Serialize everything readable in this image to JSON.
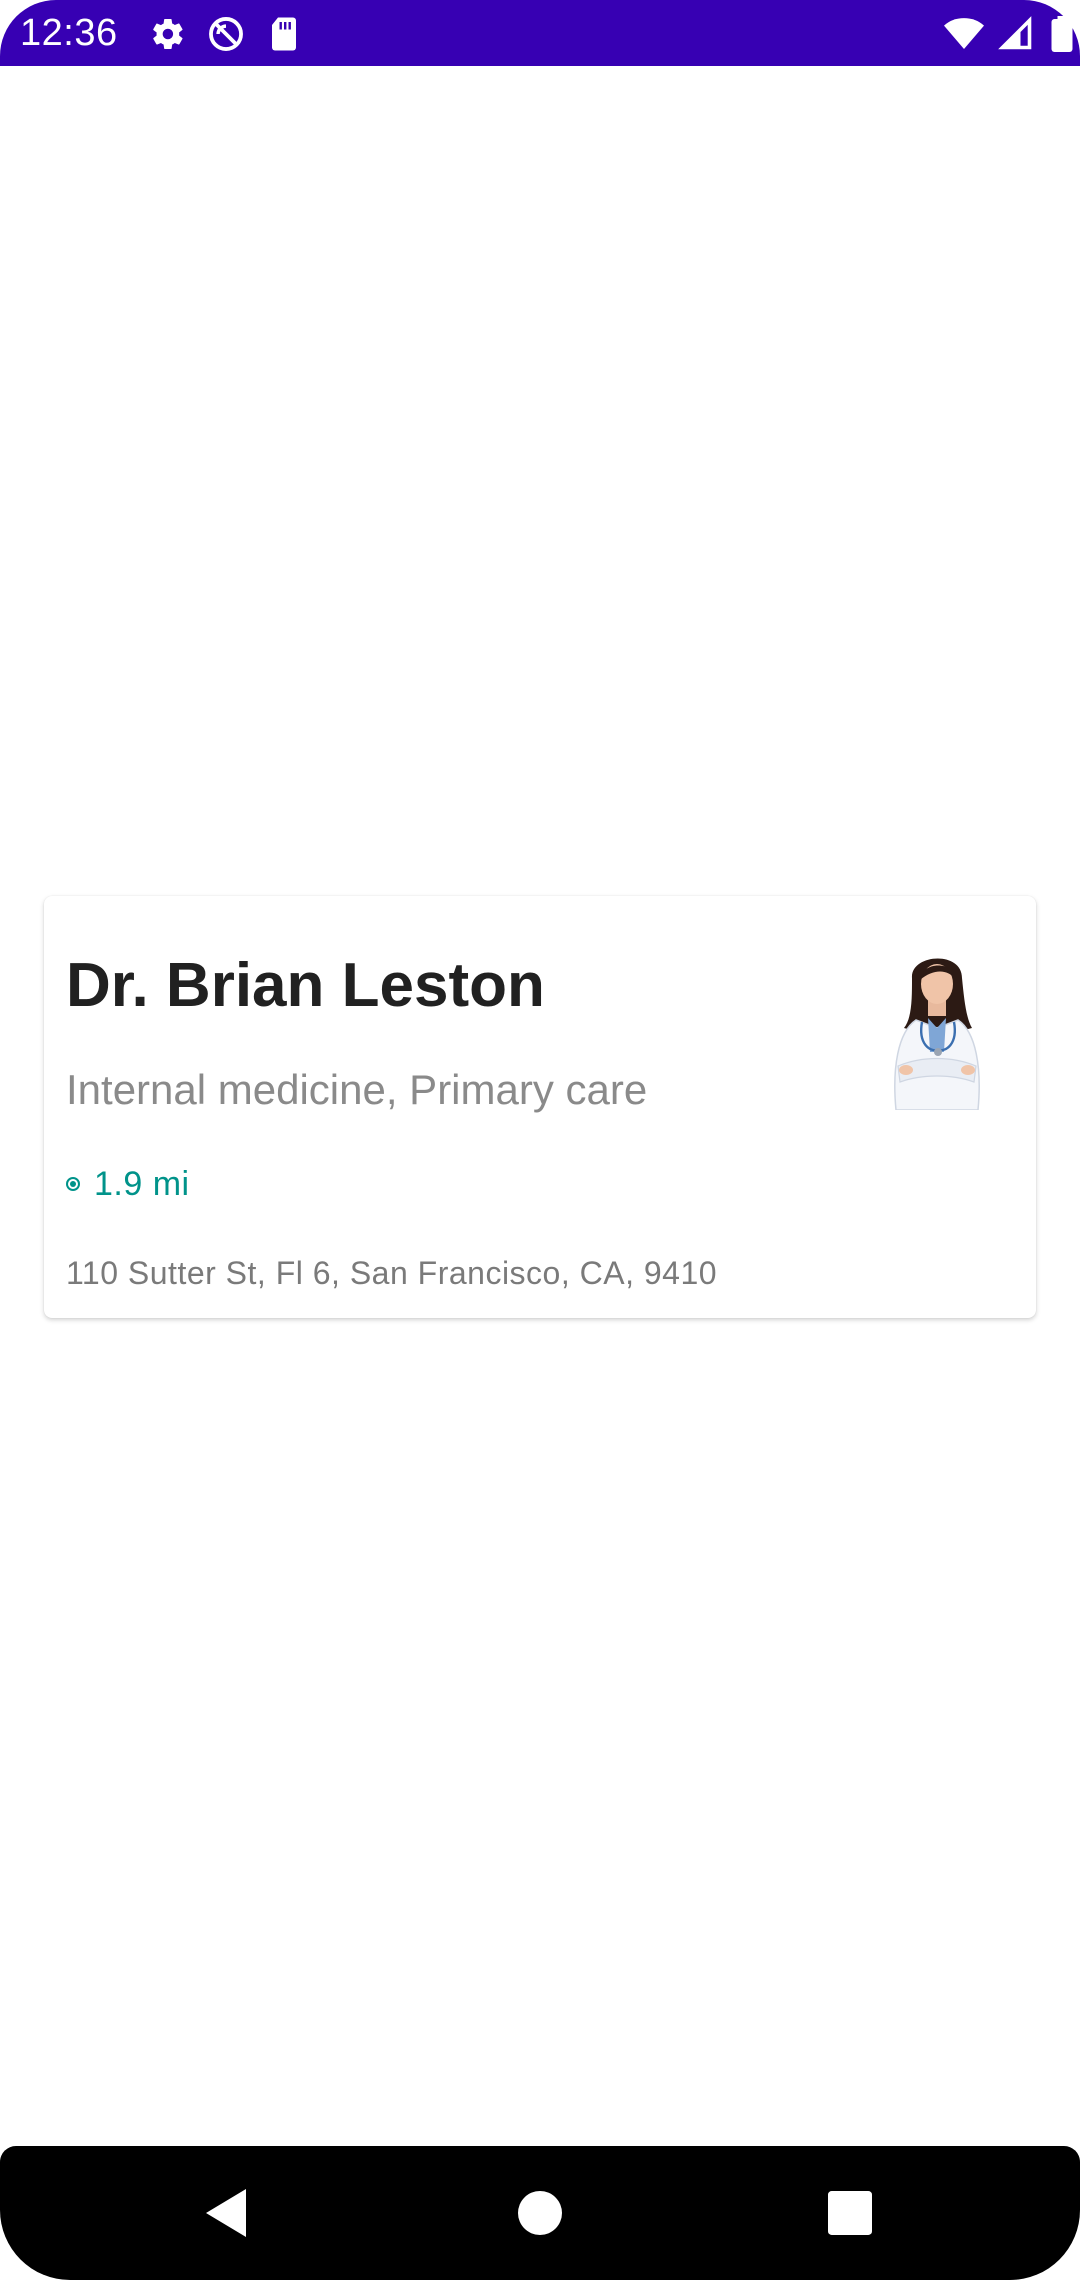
{
  "status_bar": {
    "time": "12:36",
    "background_color": "#3700b3",
    "left_icons": [
      "gear-icon",
      "no-disturb-icon",
      "sd-card-icon"
    ],
    "right_icons": [
      "wifi-icon",
      "signal-icon",
      "battery-icon"
    ]
  },
  "doctor_card": {
    "name": "Dr. Brian Leston",
    "specialty": "Internal medicine, Primary care",
    "distance": "1.9 mi",
    "distance_icon": "location-dot-icon",
    "address": "110 Sutter St, Fl 6, San Francisco, CA, 9410",
    "avatar_icon": "doctor-avatar",
    "accent_color": "#00938a"
  },
  "navigation_bar": {
    "buttons": [
      "back-icon",
      "home-icon",
      "recents-icon"
    ]
  }
}
